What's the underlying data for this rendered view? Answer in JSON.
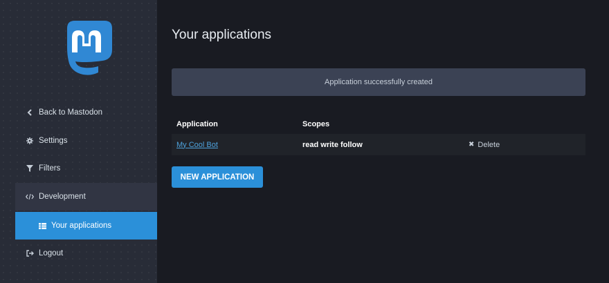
{
  "sidebar": {
    "logo_icon": "mastodon-logo-icon",
    "items": [
      {
        "label": "Back to Mastodon",
        "icon": "chevron-left-icon"
      },
      {
        "label": "Settings",
        "icon": "gear-icon"
      },
      {
        "label": "Filters",
        "icon": "filter-icon"
      },
      {
        "label": "Development",
        "icon": "code-icon"
      },
      {
        "label": "Your applications",
        "icon": "list-icon"
      },
      {
        "label": "Logout",
        "icon": "sign-out-icon"
      }
    ],
    "active_item": "Your applications"
  },
  "main": {
    "title": "Your applications",
    "flash": "Application successfully created",
    "table": {
      "headers": [
        "Application",
        "Scopes",
        ""
      ],
      "rows": [
        {
          "application": "My Cool Bot",
          "scopes": "read write follow",
          "action": "Delete"
        }
      ]
    },
    "new_button": "NEW APPLICATION"
  },
  "colors": {
    "accent": "#2b90d9",
    "background": "#191b22",
    "sidebar": "#282c37",
    "flash": "#3b4254"
  }
}
